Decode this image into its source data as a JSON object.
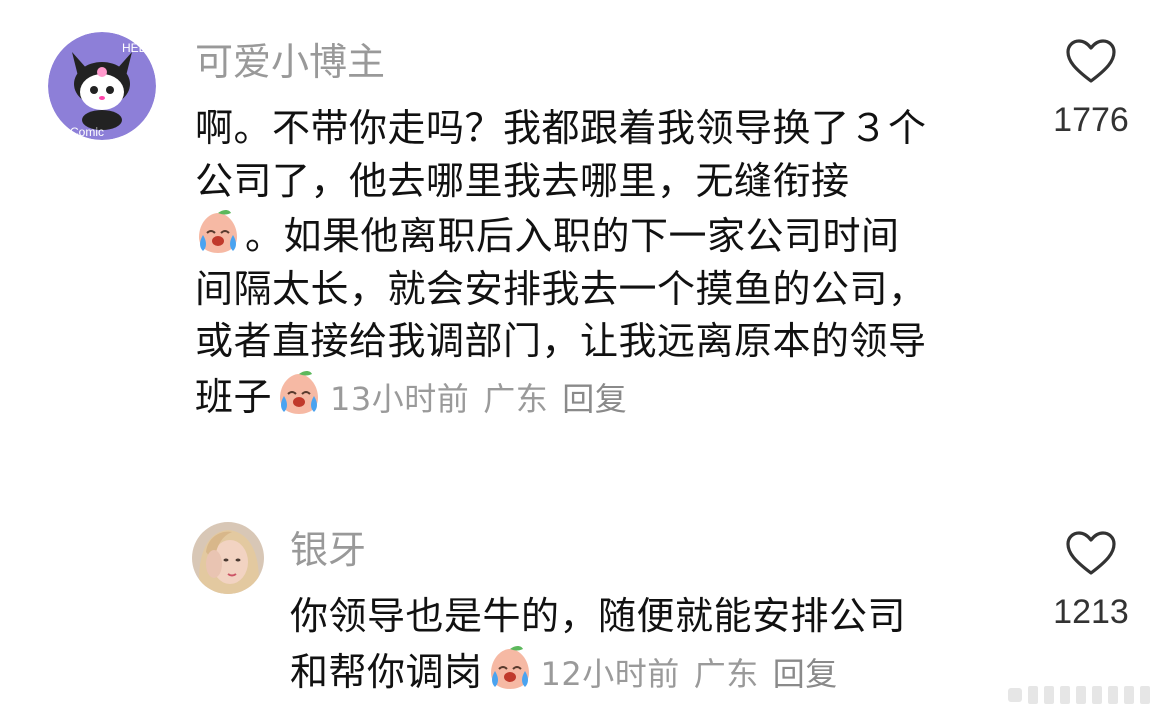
{
  "comments": [
    {
      "username": "可爱小博主",
      "avatar_icon": "kuromi-hello-avatar",
      "text_lines": [
        "啊。不带你走吗？我都跟着我领导换了３个",
        "公司了，他去哪里我去哪里，无缝衔接",
        "。如果他离职后入职的下一家公司时间",
        "间隔太长，就会安排我去一个摸鱼的公司，",
        "或者直接给我调部门，让我远离原本的领导",
        "班子"
      ],
      "time": "13小时前",
      "location": "广东",
      "reply_label": "回复",
      "like_count": "1776"
    },
    {
      "username": "银牙",
      "avatar_icon": "selfie-photo-avatar",
      "text_lines": [
        "你领导也是牛的，随便就能安排公司",
        "和帮你调岗"
      ],
      "time": "12小时前",
      "location": "广东",
      "reply_label": "回复",
      "like_count": "1213"
    }
  ],
  "icons": {
    "emoji": "crying-peach-emoji",
    "like": "heart-outline-icon"
  },
  "colors": {
    "background": "#ffffff",
    "text": "#111111",
    "username": "#999999",
    "meta": "#9a9a9a",
    "avatar_purple": "#8d7fd8"
  }
}
